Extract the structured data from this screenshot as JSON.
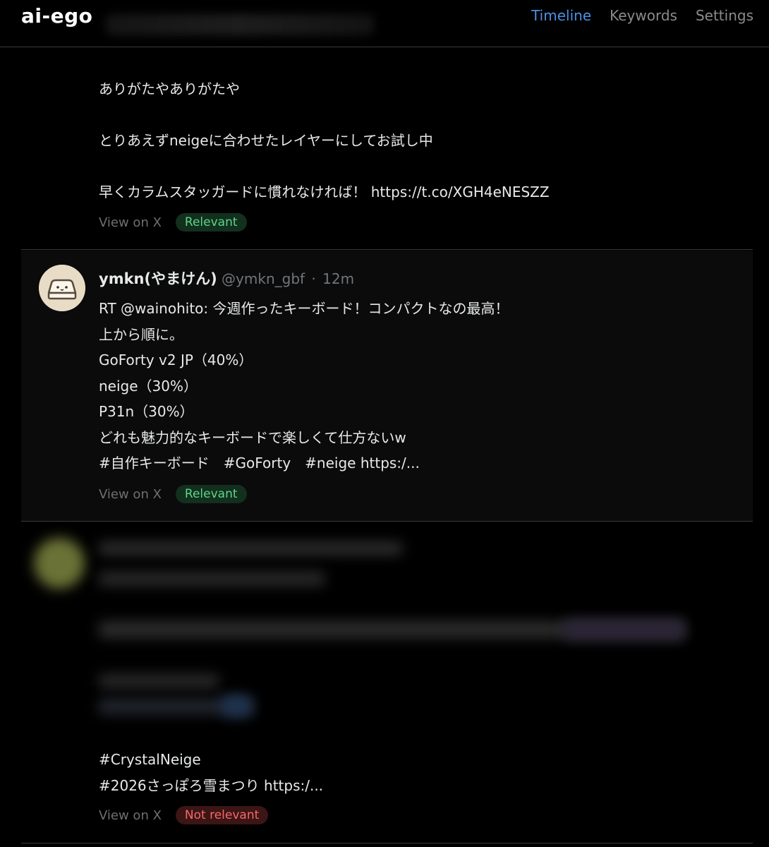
{
  "header": {
    "brand": "ai-ego",
    "nav": {
      "timeline": "Timeline",
      "keywords": "Keywords",
      "settings": "Settings"
    }
  },
  "colors": {
    "accent": "#4a90e2",
    "relevant": "#5fd48a",
    "not_relevant": "#f36a6a"
  },
  "posts": [
    {
      "text": "ありがたやありがたや\n\nとりあえずneigeに合わせたレイヤーにしてお試し中\n\n早くカラムスタッガードに慣れなければ！ https://t.co/XGH4eNESZZ",
      "view_label": "View on X",
      "badge": "Relevant"
    },
    {
      "author_name": "ymkn(やまけん)",
      "author_handle": "@ymkn_gbf",
      "separator": "·",
      "time": "12m",
      "avatar_icon": "keyboard-keycap-icon",
      "text": "RT @wainohito: 今週作ったキーボード！コンパクトなの最高！\n上から順に。\nGoForty v2 JP（40%）\nneige（30%）\nP31n（30%）\nどれも魅力的なキーボードで楽しくて仕方ないw\n#自作キーボード　#GoForty　#neige https:/...",
      "view_label": "View on X",
      "badge": "Relevant"
    },
    {
      "text": "#CrystalNeige\n#2026さっぽろ雪まつり https:/...",
      "view_label": "View on X",
      "badge": "Not relevant"
    }
  ]
}
